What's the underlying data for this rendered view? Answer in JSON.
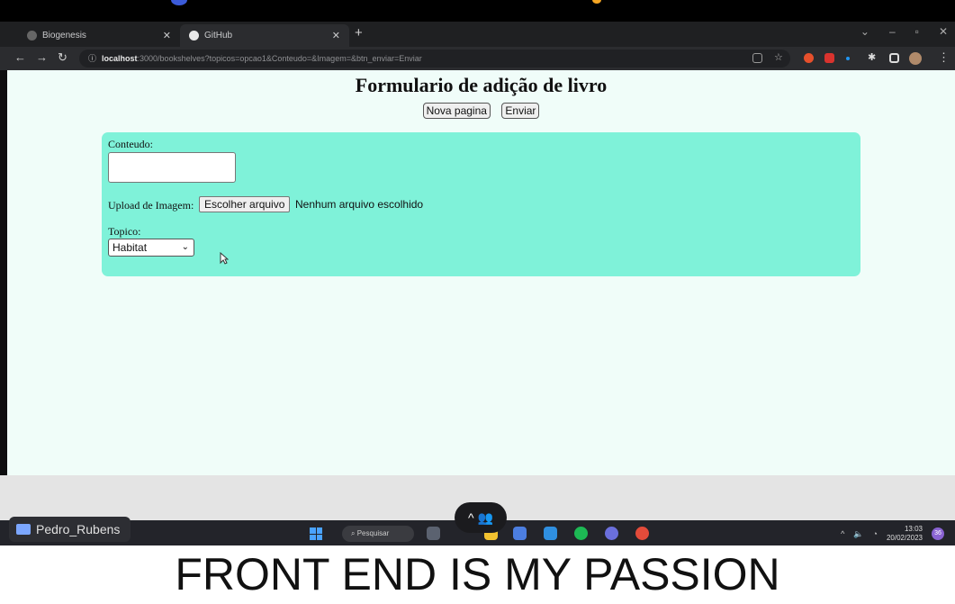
{
  "browser": {
    "tabs": [
      {
        "label": "Biogenesis",
        "active": false
      },
      {
        "label": "GitHub",
        "active": true
      }
    ],
    "new_tab": "+",
    "url_host": "localhost",
    "url_rest": ":3000/bookshelves?topicos=opcao1&Conteudo=&Imagem=&btn_enviar=Enviar",
    "icons": [
      "back-icon",
      "forward-icon",
      "reload-icon",
      "info-icon"
    ]
  },
  "page": {
    "title": "Formulario de adição de livro",
    "buttons": {
      "new_page": "Nova pagina",
      "send": "Enviar"
    },
    "form": {
      "content_label": "Conteudo:",
      "upload_label": "Upload de Imagem:",
      "file_button": "Escolher arquivo",
      "file_status": "Nenhum arquivo escolhido",
      "topic_label": "Topico:",
      "topic_selected": "Habitat"
    },
    "colors": {
      "panel": "#7ff2d9",
      "background": "#f0fdf9"
    }
  },
  "taskbar": {
    "presenter": "Pedro_Rubens",
    "search": "Pesquisar",
    "time": "13:03",
    "date": "20/02/2023",
    "notification_count": "36"
  },
  "caption": "FRONT END IS MY PASSION"
}
